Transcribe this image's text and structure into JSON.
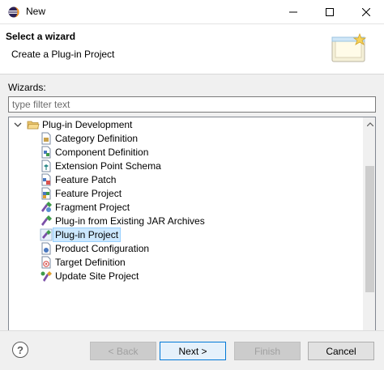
{
  "window": {
    "title": "New"
  },
  "banner": {
    "title": "Select a wizard",
    "description": "Create a Plug-in Project"
  },
  "wizards": {
    "label": "Wizards:",
    "filter_placeholder": "type filter text",
    "category": "Plug-in Development",
    "items": [
      {
        "label": "Category Definition",
        "icon": "category-definition-icon"
      },
      {
        "label": "Component Definition",
        "icon": "component-definition-icon"
      },
      {
        "label": "Extension Point Schema",
        "icon": "extension-point-schema-icon"
      },
      {
        "label": "Feature Patch",
        "icon": "feature-patch-icon"
      },
      {
        "label": "Feature Project",
        "icon": "feature-project-icon"
      },
      {
        "label": "Fragment Project",
        "icon": "fragment-project-icon"
      },
      {
        "label": "Plug-in from Existing JAR Archives",
        "icon": "plugin-jar-icon"
      },
      {
        "label": "Plug-in Project",
        "icon": "plugin-project-icon",
        "selected": true
      },
      {
        "label": "Product Configuration",
        "icon": "product-configuration-icon"
      },
      {
        "label": "Target Definition",
        "icon": "target-definition-icon"
      },
      {
        "label": "Update Site Project",
        "icon": "update-site-project-icon"
      }
    ]
  },
  "buttons": {
    "back": "< Back",
    "next": "Next >",
    "finish": "Finish",
    "cancel": "Cancel",
    "help": "?"
  },
  "colors": {
    "selection": "#cce8ff",
    "selection_border": "#99d1ff",
    "default_button_border": "#0078d7"
  }
}
